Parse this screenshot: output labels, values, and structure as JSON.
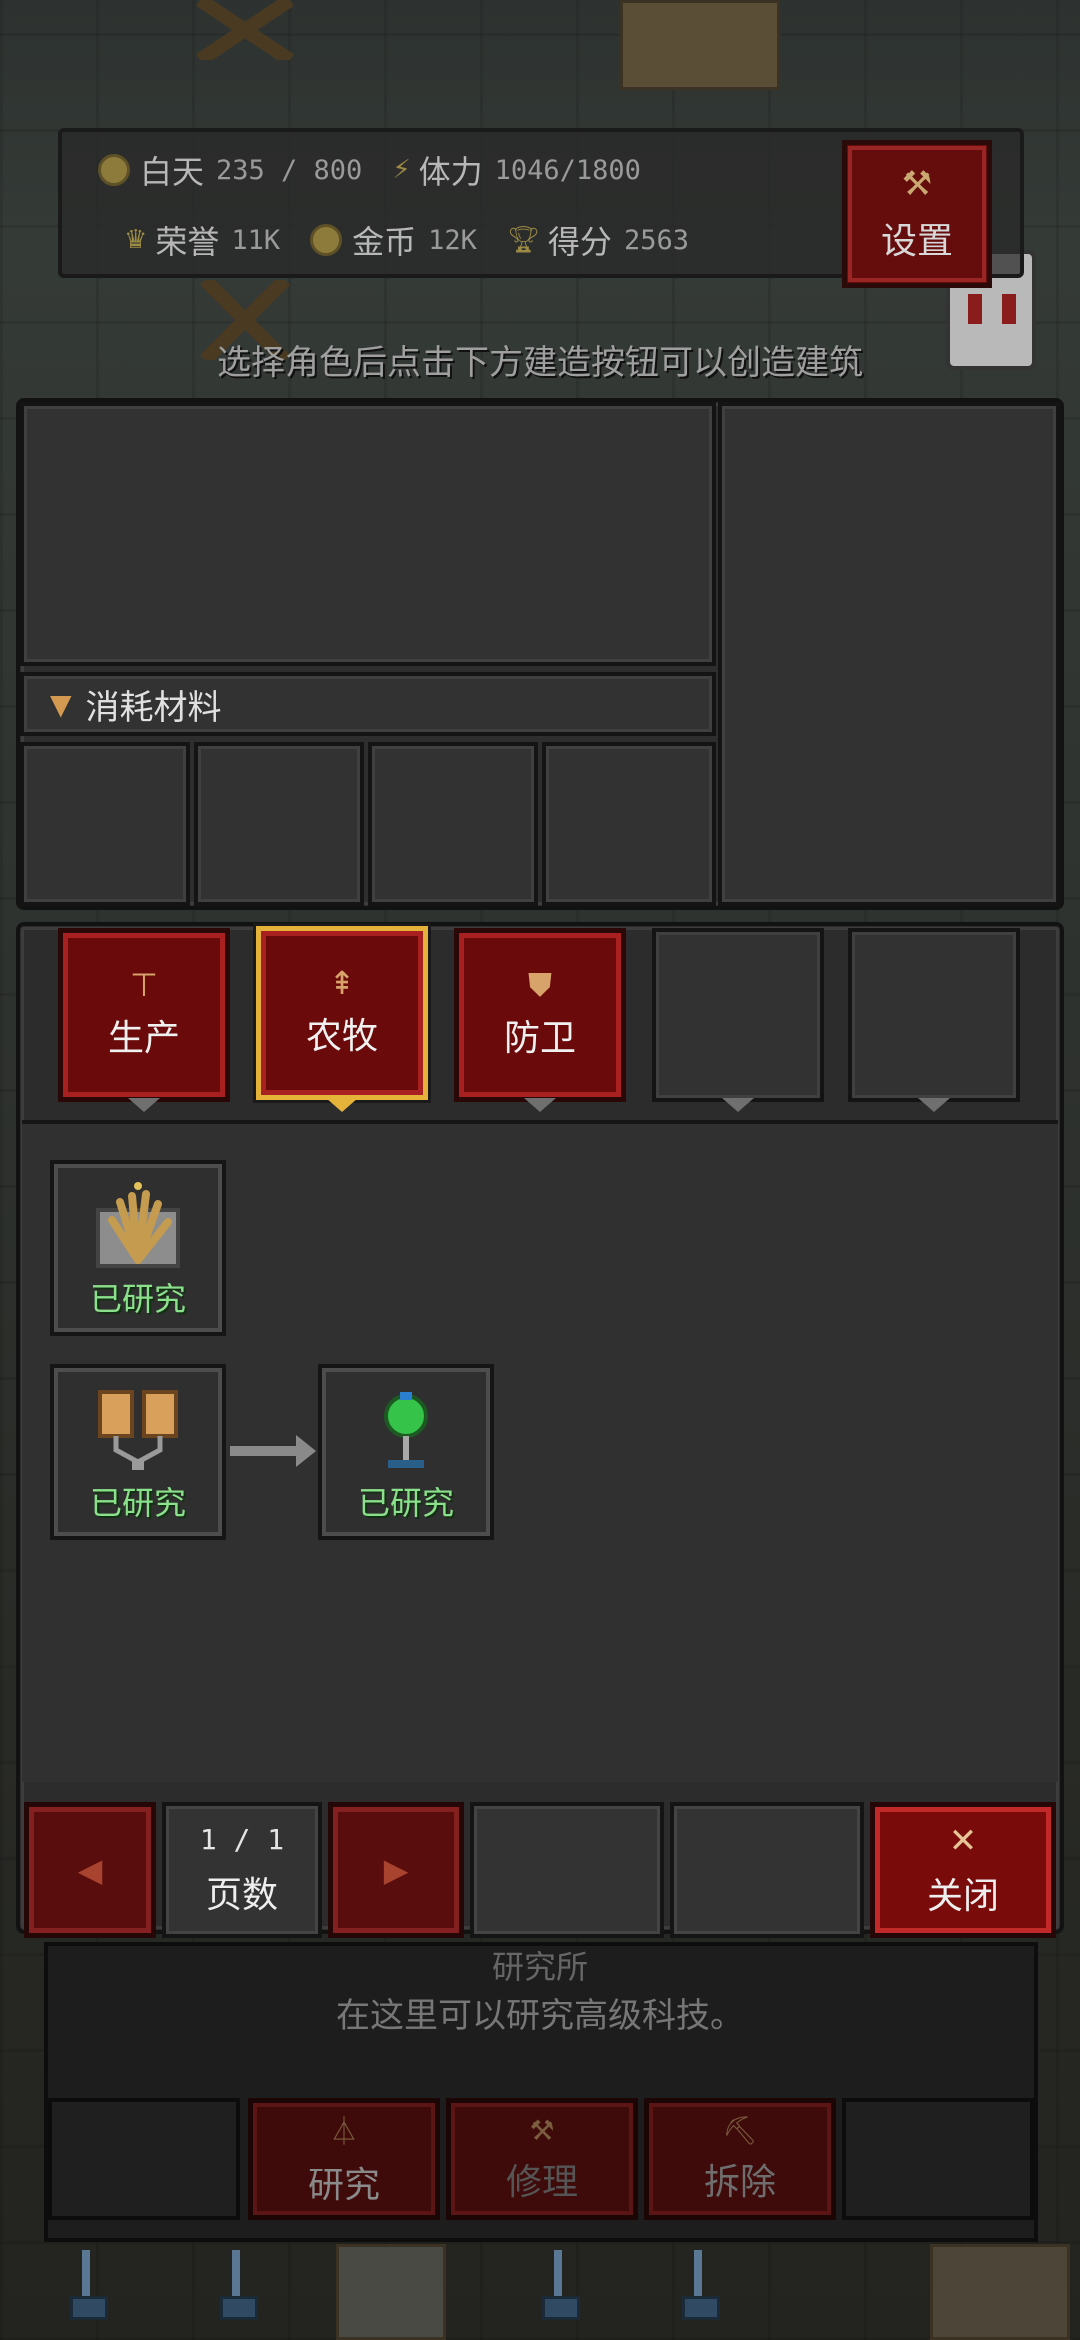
{
  "hud": {
    "day_label": "白天",
    "day_value": "235 / 800",
    "stamina_label": "体力",
    "stamina_value": "1046/1800",
    "honor_label": "荣誉",
    "honor_value": "11K",
    "gold_label": "金币",
    "gold_value": "12K",
    "score_label": "得分",
    "score_value": "2563"
  },
  "settings_label": "设置",
  "hint": "选择角色后点击下方建造按钮可以创造建筑",
  "info_panel": {
    "materials_label": "消耗材料"
  },
  "tabs": [
    {
      "label": "生产",
      "icon": "anvil-icon"
    },
    {
      "label": "农牧",
      "icon": "tree-icon"
    },
    {
      "label": "防卫",
      "icon": "shield-icon"
    }
  ],
  "tech_tree": [
    {
      "status": "已研究",
      "icon": "wheat-icon"
    },
    {
      "status": "已研究",
      "icon": "jars-icon"
    },
    {
      "status": "已研究",
      "icon": "flask-icon"
    }
  ],
  "pagination": {
    "page": "1 / 1",
    "label": "页数"
  },
  "close_label": "关闭",
  "building": {
    "name": "研究所",
    "description": "在这里可以研究高级科技。",
    "actions": [
      "研究",
      "修理",
      "拆除"
    ]
  },
  "colors": {
    "accent_red": "#6a0a0a",
    "selected_border": "#e5b23a",
    "researched_green": "#8be08b"
  }
}
